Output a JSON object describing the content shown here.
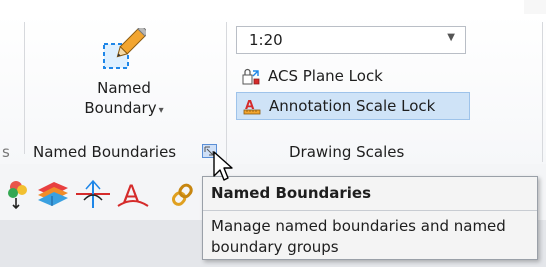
{
  "ribbon": {
    "left_group": {
      "button": {
        "label_line1": "Named",
        "label_line2": "Boundary",
        "caret": "▾",
        "icon": "named-boundary-pencil-icon"
      },
      "title": "Named Boundaries",
      "left_cut_text": "s",
      "launcher_icon": "dialog-launcher-icon"
    },
    "right_group": {
      "scale_value": "1:20",
      "dropdown_arrow": "▼",
      "acs_label": "ACS Plane Lock",
      "annotation_label": "Annotation Scale Lock",
      "title": "Drawing Scales"
    }
  },
  "toolbar": {
    "icons": [
      "multi-color-tool-icon",
      "surface-layers-icon",
      "plane-axis-icon",
      "text-tool-icon",
      "chain-link-icon"
    ]
  },
  "tooltip": {
    "title": "Named Boundaries",
    "description": "Manage named boundaries and named boundary groups"
  },
  "colors": {
    "accent_blue": "#1e86e8",
    "highlight": "#cfe3f7",
    "text_red": "#d52b2b"
  }
}
